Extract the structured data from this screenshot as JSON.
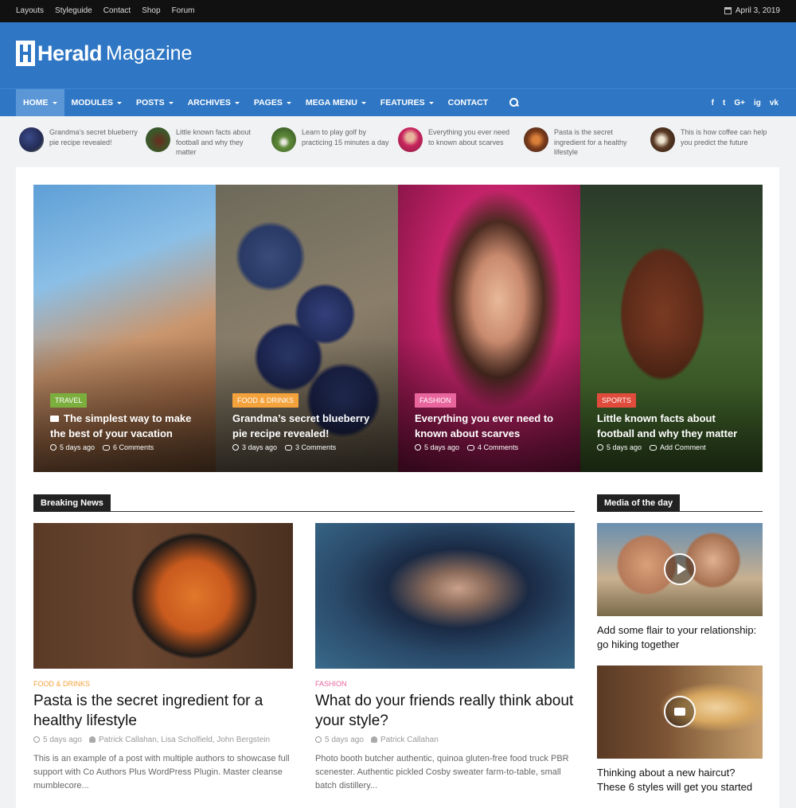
{
  "topbar": {
    "links": [
      "Layouts",
      "Styleguide",
      "Contact",
      "Shop",
      "Forum"
    ],
    "date": "April 3, 2019"
  },
  "header": {
    "logo_bold": "Herald",
    "logo_light": "Magazine"
  },
  "nav": {
    "items": [
      {
        "label": "HOME",
        "dropdown": true,
        "active": true
      },
      {
        "label": "MODULES",
        "dropdown": true
      },
      {
        "label": "POSTS",
        "dropdown": true
      },
      {
        "label": "ARCHIVES",
        "dropdown": true
      },
      {
        "label": "PAGES",
        "dropdown": true
      },
      {
        "label": "MEGA MENU",
        "dropdown": true
      },
      {
        "label": "FEATURES",
        "dropdown": true
      },
      {
        "label": "CONTACT",
        "dropdown": false
      }
    ],
    "social": [
      "f",
      "t",
      "G+",
      "ig",
      "vk"
    ]
  },
  "ticker": [
    {
      "text": "Grandma’s secret blueberry pie recipe revealed!"
    },
    {
      "text": "Little known facts about football and why they matter"
    },
    {
      "text": "Learn to play golf by practicing 15 minutes a day"
    },
    {
      "text": "Everything you ever need to known about scarves"
    },
    {
      "text": "Pasta is the secret ingredient for a healthy lifestyle"
    },
    {
      "text": "This is how coffee can help you predict the future"
    }
  ],
  "slides": [
    {
      "category": "TRAVEL",
      "cat_color": "#7cae3d",
      "title": "The simplest way to make the best of your vacation",
      "time": "5 days ago",
      "comments": "6 Comments"
    },
    {
      "category": "FOOD & DRINKS",
      "cat_color": "#f4a23c",
      "title": "Grandma’s secret blueberry pie recipe revealed!",
      "time": "3 days ago",
      "comments": "3 Comments"
    },
    {
      "category": "FASHION",
      "cat_color": "#e8669d",
      "title": "Everything you ever need to known about scarves",
      "time": "5 days ago",
      "comments": "4 Comments"
    },
    {
      "category": "SPORTS",
      "cat_color": "#e04b3b",
      "title": "Little known facts about football and why they matter",
      "time": "5 days ago",
      "comments": "Add Comment"
    }
  ],
  "breaking_news": {
    "heading": "Breaking News",
    "articles": [
      {
        "category": "FOOD & DRINKS",
        "cat_color": "#f4a23c",
        "title": "Pasta is the secret ingredient for a healthy lifestyle",
        "time": "5 days ago",
        "authors": "Patrick Callahan, Lisa Scholfield, John Bergstein",
        "excerpt": "This is an example of a post with multiple authors to showcase full support with Co Authors Plus WordPress Plugin. Master cleanse mumblecore..."
      },
      {
        "category": "FASHION",
        "cat_color": "#e8669d",
        "title": "What do your friends really think about your style?",
        "time": "5 days ago",
        "authors": "Patrick Callahan",
        "excerpt": "Photo booth butcher authentic, quinoa gluten-free food truck PBR scenester. Authentic pickled Cosby sweater farm-to-table, small batch distillery..."
      }
    ]
  },
  "media_of_day": {
    "heading": "Media of the day",
    "items": [
      {
        "title": "Add some flair to your relationship: go hiking together",
        "icon": "play-icon"
      },
      {
        "title": "Thinking about a new haircut? These 6 styles will get you started",
        "icon": "camera-icon"
      }
    ]
  },
  "colors": {
    "brand": "#2f77c4",
    "topbar": "#111111",
    "nav_active": "#5b97d6"
  }
}
